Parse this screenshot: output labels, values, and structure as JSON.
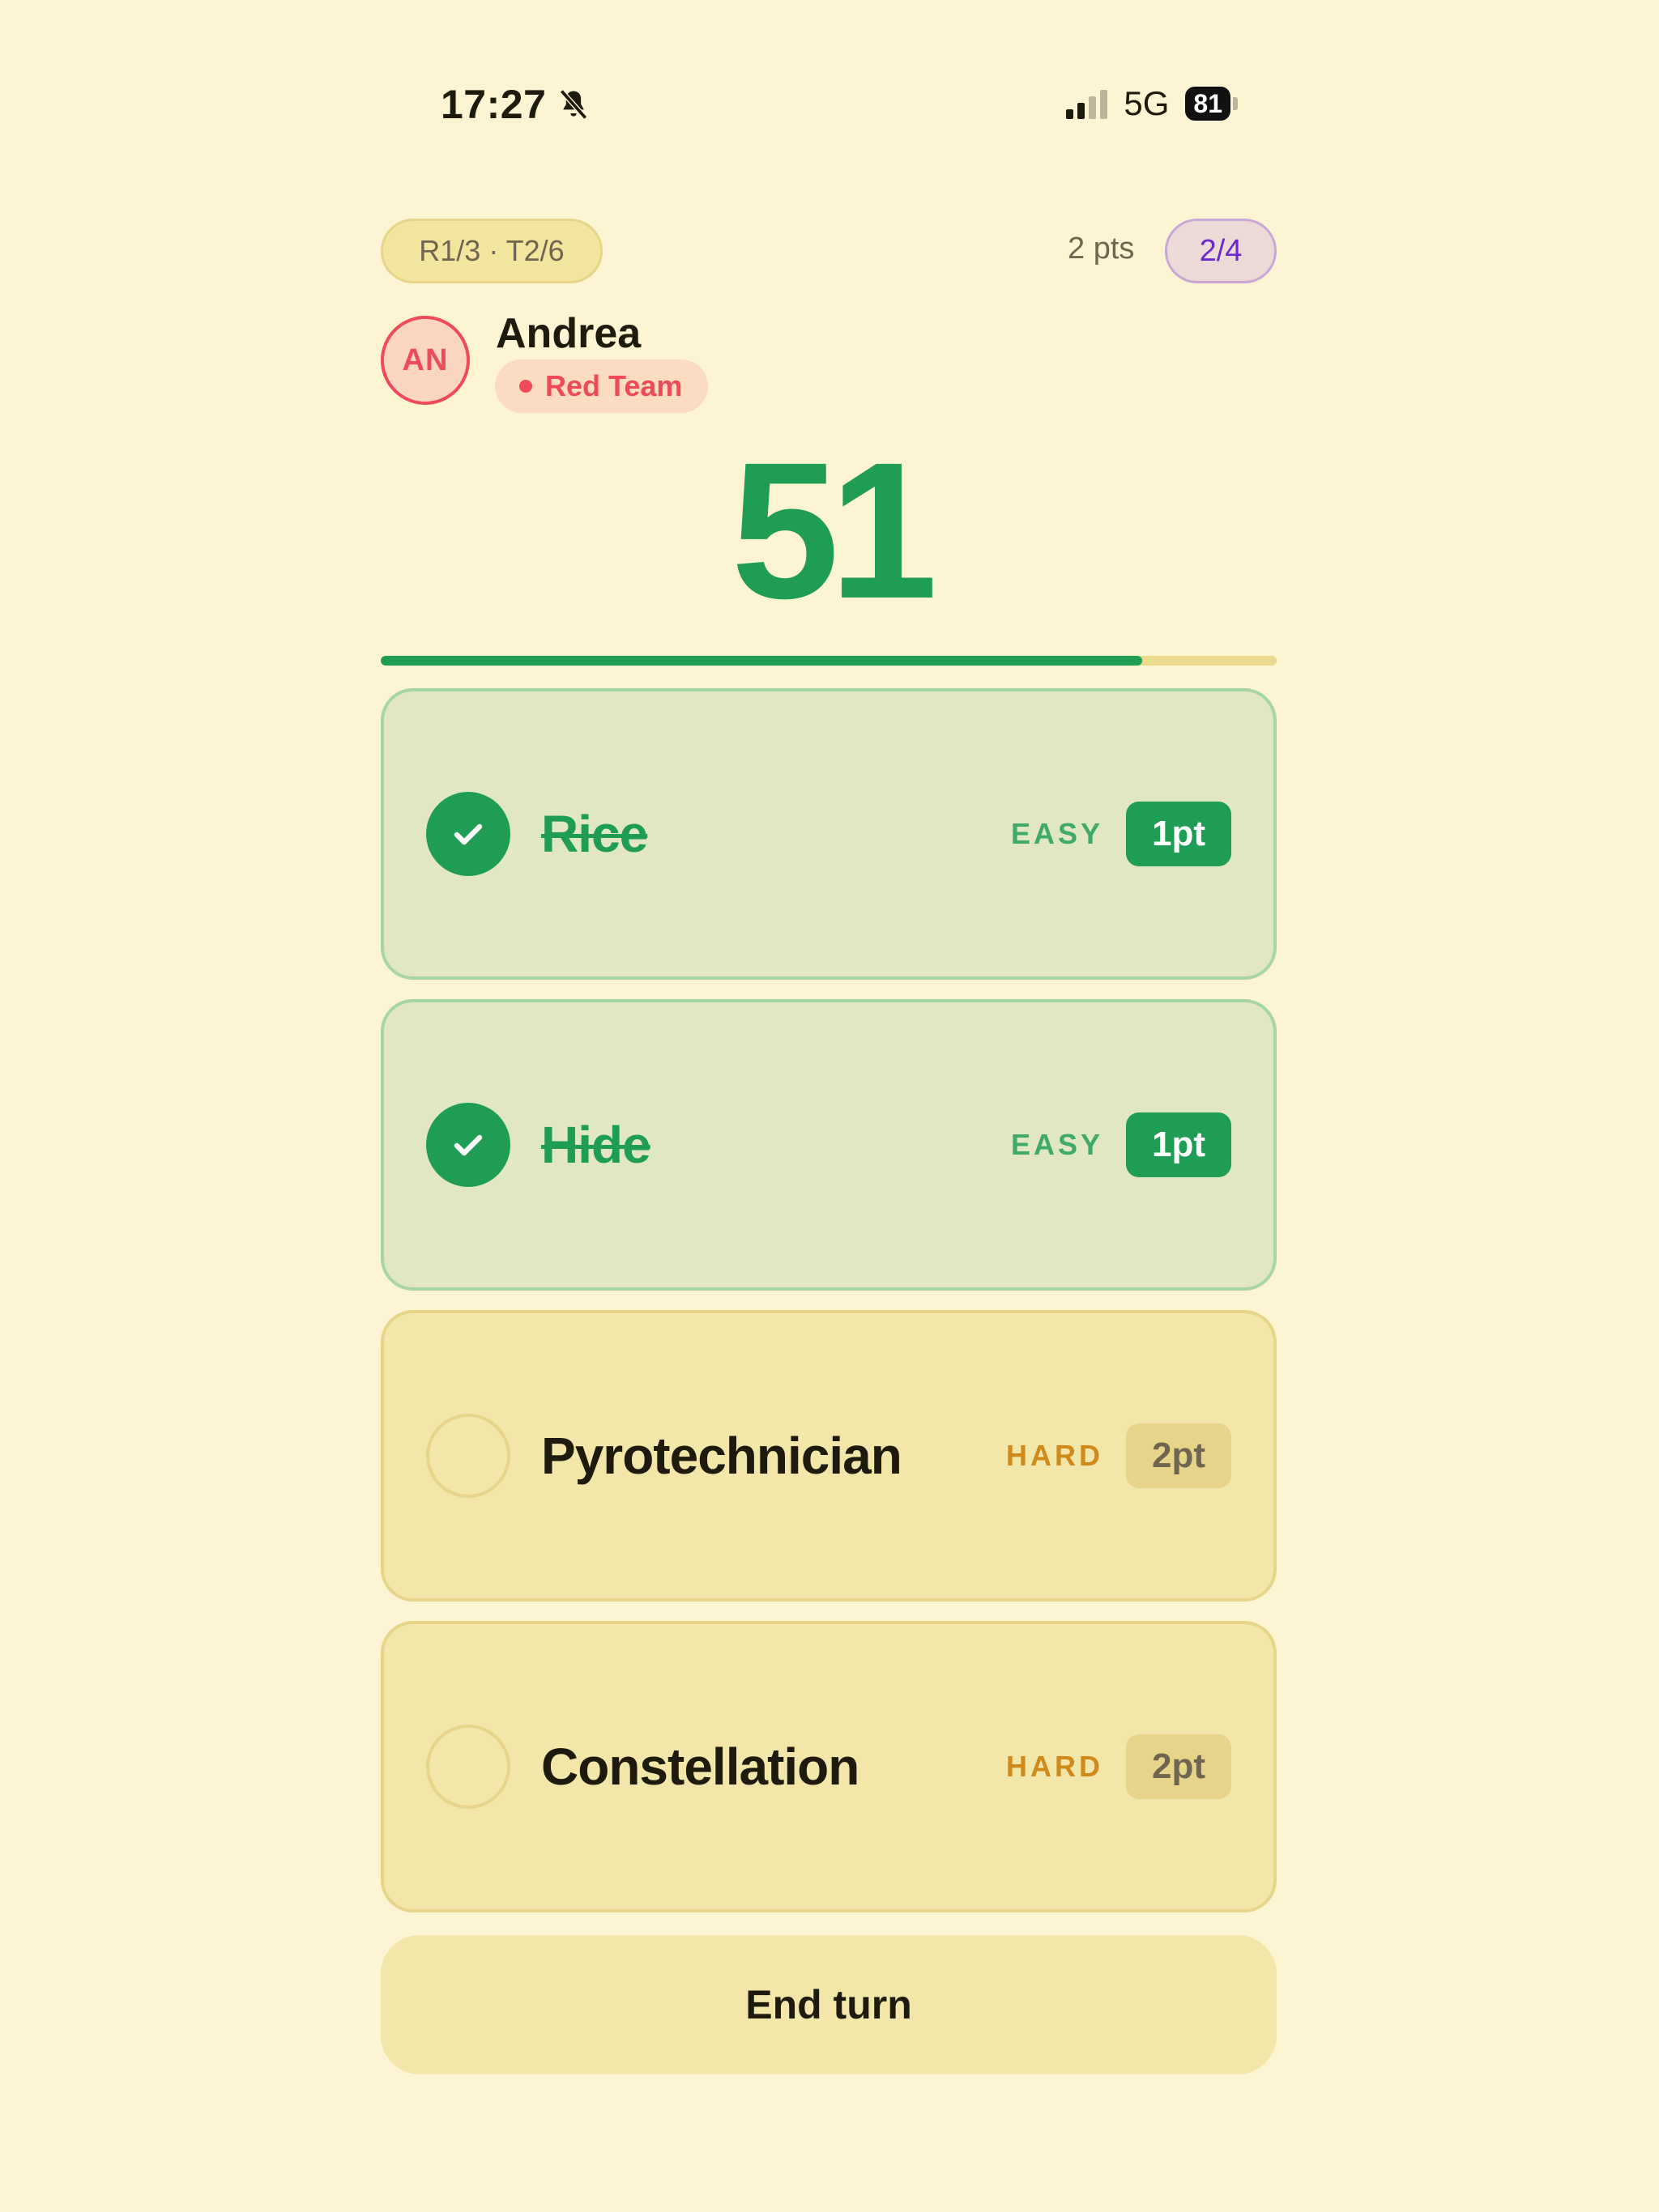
{
  "status_bar": {
    "time": "17:27",
    "network": "5G",
    "battery": "81",
    "icons": [
      "bell-slash-icon",
      "signal-icon",
      "battery-icon"
    ]
  },
  "header": {
    "round_turn": "R1/3 · T2/6",
    "points": "2 pts",
    "progress": "2/4"
  },
  "player": {
    "initials": "AN",
    "name": "Andrea",
    "team": "Red Team",
    "team_color": "#EE4A5C"
  },
  "timer": {
    "seconds": "51",
    "remaining_fraction": 0.85,
    "color": "#1F9D55"
  },
  "words": [
    {
      "word": "Rice",
      "difficulty": "EASY",
      "points": "1pt",
      "done": true
    },
    {
      "word": "Hide",
      "difficulty": "EASY",
      "points": "1pt",
      "done": true
    },
    {
      "word": "Pyrotechnician",
      "difficulty": "HARD",
      "points": "2pt",
      "done": false
    },
    {
      "word": "Constellation",
      "difficulty": "HARD",
      "points": "2pt",
      "done": false
    }
  ],
  "actions": {
    "end_turn": "End turn"
  }
}
